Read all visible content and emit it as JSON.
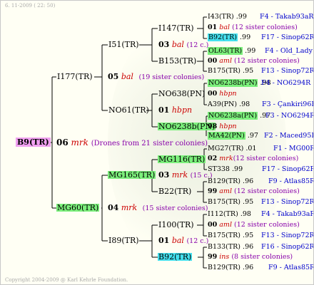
{
  "header": {
    "date_line": "6. 11-2009 ( 22: 50)"
  },
  "footer": {
    "copyright": "Copyright 2004-2009 @ Karl Kehrle Foundation."
  },
  "root": {
    "id": "B9(TR)",
    "gen": "06",
    "breeder": "mrk",
    "note": "(Drones from 21 sister colonies)"
  },
  "gen1": {
    "top": {
      "id": "I177(TR)",
      "gen": "05",
      "breeder": "bal",
      "note": "(19 sister colonies)"
    },
    "bottom": {
      "id": "MG60(TR)",
      "gen": "04",
      "breeder": "mrk",
      "note": "(15 sister colonies)"
    }
  },
  "gen2": [
    {
      "id": "I51(TR)",
      "gen": "03",
      "breeder": "bal",
      "note": "(12 c.)"
    },
    {
      "id": "NO61(TR)",
      "gen": "01",
      "breeder": "hbpn",
      "note": ""
    },
    {
      "id": "MG165(TR)",
      "gen": "03",
      "breeder": "mrk",
      "note": "(15 c.)"
    },
    {
      "id": "I89(TR)",
      "gen": "01",
      "breeder": "bal",
      "note": "(12 c.)"
    }
  ],
  "gen3": [
    {
      "id": "I147(TR)"
    },
    {
      "id": "B153(TR)"
    },
    {
      "id": "NO638(PN)"
    },
    {
      "id": "NO6238b(PN)"
    },
    {
      "id": "MG116(TR)"
    },
    {
      "id": "B22(TR)"
    },
    {
      "id": "I100(TR)"
    },
    {
      "id": "B92(TR)"
    }
  ],
  "gen4": [
    {
      "id": "I43(TR)",
      "score": ".99",
      "loc": "F4 - Takab93aR"
    },
    {
      "gen": "01",
      "breeder": "bal",
      "note": "(12 sister colonies)"
    },
    {
      "id": "B92(TR)",
      "score": ".99",
      "loc": "F17 - Sinop62R"
    },
    {
      "id": "OL63(TR)",
      "score": ".99",
      "loc": "F4 - Old_Lady"
    },
    {
      "gen": "00",
      "breeder": "aml",
      "note": "(12 sister colonies)"
    },
    {
      "id": "B175(TR)",
      "score": ".95",
      "loc": "F13 - Sinop72R"
    },
    {
      "id": "NO6238b(PN)",
      "score": ".98",
      "loc": "F4 - NO6294R"
    },
    {
      "gen": "00",
      "breeder": "hbpn",
      "note": ""
    },
    {
      "id": "A39(PN)",
      "score": ".98",
      "loc": "F3 - Çankiri96R"
    },
    {
      "id": "NO6238a(PN)",
      "score": ".97",
      "loc": "F3 - NO6294R"
    },
    {
      "gen": "98",
      "breeder": "hbpn",
      "note": ""
    },
    {
      "id": "MA42(PN)",
      "score": ".97",
      "loc": "F2 - Maced95R"
    },
    {
      "id": "MG27(TR)",
      "score": ".01",
      "loc": "F1 - MG00R"
    },
    {
      "gen": "02",
      "breeder": "mrk",
      "note": "(12 sister colonies)"
    },
    {
      "id": "ST338",
      "score": ".99",
      "loc": "F17 - Sinop62R"
    },
    {
      "id": "B129(TR)",
      "score": ".96",
      "loc": "F9 - Atlas85R"
    },
    {
      "gen": "99",
      "breeder": "aml",
      "note": "(12 sister colonies)"
    },
    {
      "id": "B175(TR)",
      "score": ".95",
      "loc": "F13 - Sinop72R"
    },
    {
      "id": "I112(TR)",
      "score": ".98",
      "loc": "F4 - Takab93aR"
    },
    {
      "gen": "00",
      "breeder": "aml",
      "note": "(12 sister colonies)"
    },
    {
      "id": "B175(TR)",
      "score": ".95",
      "loc": "F13 - Sinop72R"
    },
    {
      "id": "B133(TR)",
      "score": ".96",
      "loc": "F16 - Sinop62R"
    },
    {
      "gen": "99",
      "breeder": "ins",
      "note": "(8 sister colonies)"
    },
    {
      "id": "B129(TR)",
      "score": ".96",
      "loc": "F9 - Atlas85R"
    }
  ],
  "colors": {
    "green_highlight": "#7cf07c",
    "cyan_highlight": "#44e0ee",
    "root_highlight": "#f0a0f0",
    "location_blue": "#0000cc",
    "breeder_red": "#cc0000",
    "note_purple": "#8800aa"
  }
}
